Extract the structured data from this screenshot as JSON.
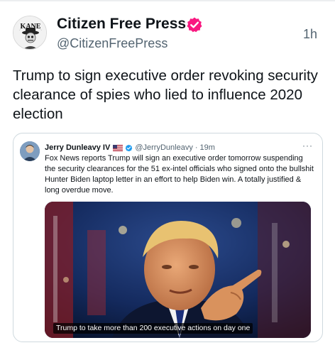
{
  "post": {
    "author_name": "Citizen Free Press",
    "handle": "@CitizenFreePress",
    "time": "1h",
    "text": "Trump to sign executive order revoking security clearance of spies who lied to influence 2020 election",
    "avatar_text": "KANE"
  },
  "quote": {
    "author_name": "Jerry Dunleavy IV",
    "handle": "@JerryDunleavy",
    "separator": "·",
    "time": "19m",
    "more": "···",
    "text": "Fox News reports Trump will sign an executive order tomorrow suspending the security clearances for the 51 ex-intel officials who signed onto the bullshit Hunter Biden laptop letter in an effort to help Biden win. A totally justified & long overdue move.",
    "media_caption": "Trump to take more than 200 executive actions on day one"
  },
  "colors": {
    "text_primary": "#0f1419",
    "text_secondary": "#536471",
    "verified_badge": "#f91880",
    "blue_check": "#1d9bf0",
    "border": "#cfd9de"
  },
  "icons": {
    "verified": "verified-badge-icon",
    "flag": "us-flag-icon",
    "more": "more-icon"
  }
}
